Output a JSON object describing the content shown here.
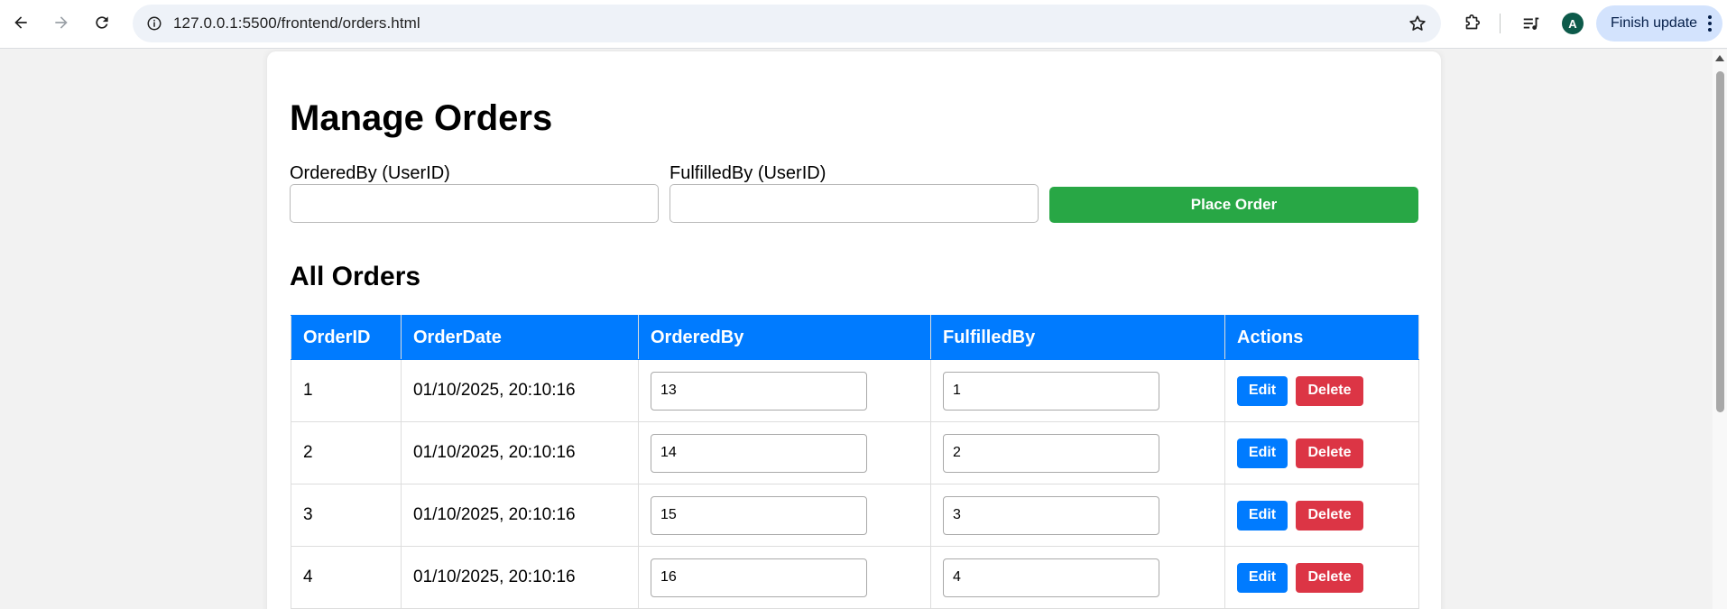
{
  "browser": {
    "url": "127.0.0.1:5500/frontend/orders.html",
    "profile_initial": "A",
    "update_label": "Finish update"
  },
  "page": {
    "title": "Manage Orders",
    "form": {
      "ordered_by_label": "OrderedBy (UserID)",
      "ordered_by_value": "",
      "fulfilled_by_label": "FulfilledBy (UserID)",
      "fulfilled_by_value": "",
      "submit_label": "Place Order"
    },
    "section_title": "All Orders",
    "table": {
      "columns": [
        "OrderID",
        "OrderDate",
        "OrderedBy",
        "FulfilledBy",
        "Actions"
      ],
      "rows": [
        {
          "order_id": "1",
          "order_date": "01/10/2025, 20:10:16",
          "ordered_by": "13",
          "fulfilled_by": "1"
        },
        {
          "order_id": "2",
          "order_date": "01/10/2025, 20:10:16",
          "ordered_by": "14",
          "fulfilled_by": "2"
        },
        {
          "order_id": "3",
          "order_date": "01/10/2025, 20:10:16",
          "ordered_by": "15",
          "fulfilled_by": "3"
        },
        {
          "order_id": "4",
          "order_date": "01/10/2025, 20:10:16",
          "ordered_by": "16",
          "fulfilled_by": "4"
        }
      ],
      "edit_label": "Edit",
      "delete_label": "Delete"
    }
  },
  "colors": {
    "primary": "#007bff",
    "success": "#28a745",
    "danger": "#dc3545"
  },
  "icons": [
    "back-arrow-icon",
    "forward-arrow-icon",
    "reload-icon",
    "site-info-icon",
    "bookmark-star-icon",
    "extensions-icon",
    "media-control-icon",
    "kebab-menu-icon",
    "scroll-up-arrow-icon"
  ]
}
